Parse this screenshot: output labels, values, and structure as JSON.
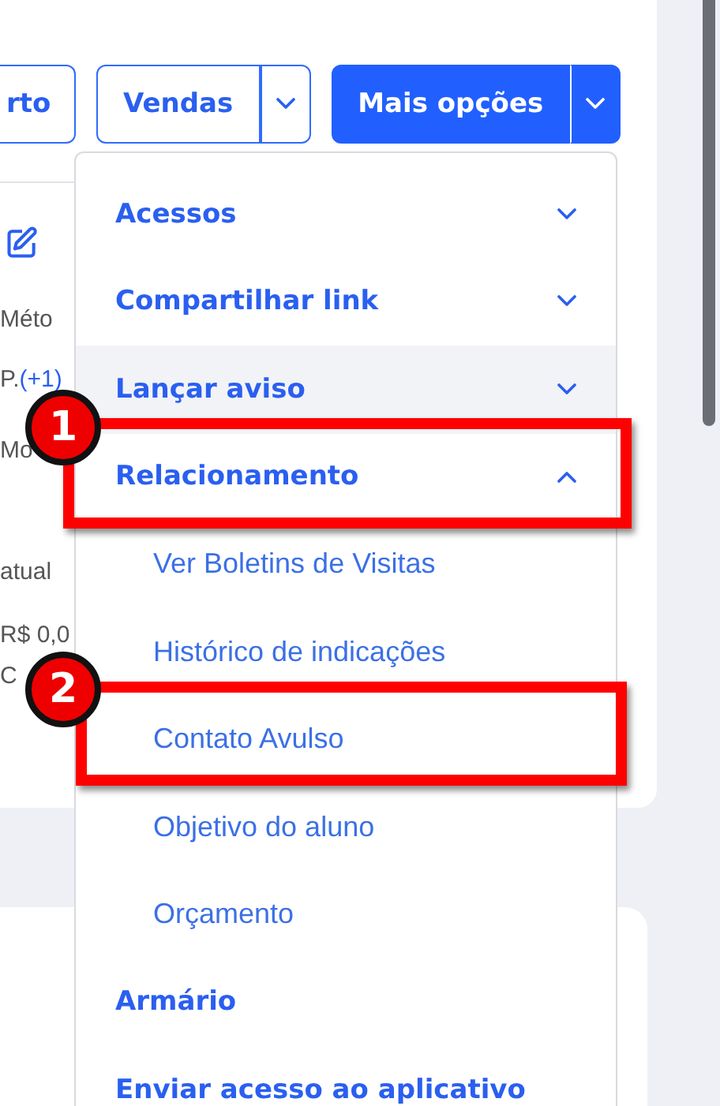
{
  "toolbar": {
    "buttons": [
      {
        "label": "rto",
        "kind": "outline"
      },
      {
        "label": "Vendas",
        "kind": "outline-split"
      },
      {
        "label": "Mais opções",
        "kind": "primary-split"
      }
    ]
  },
  "details": [
    {
      "text": "Méto"
    },
    {
      "text": "P.",
      "extra": "(+1)"
    },
    {
      "text": "Mo"
    },
    {
      "text": "atual"
    },
    {
      "text": "R$ 0,0"
    },
    {
      "text": "C"
    }
  ],
  "menu": {
    "items": [
      {
        "label": "Acessos",
        "kind": "group",
        "expanded": false,
        "hovered": false
      },
      {
        "label": "Compartilhar link",
        "kind": "group",
        "expanded": false,
        "hovered": false
      },
      {
        "label": "Lançar aviso",
        "kind": "group",
        "expanded": false,
        "hovered": true
      },
      {
        "label": "Relacionamento",
        "kind": "group",
        "expanded": true,
        "hovered": false,
        "children": [
          {
            "label": "Ver Boletins de Visitas"
          },
          {
            "label": "Histórico de indicações"
          },
          {
            "label": "Contato Avulso"
          },
          {
            "label": "Objetivo do aluno"
          },
          {
            "label": "Orçamento"
          }
        ]
      },
      {
        "label": "Armário",
        "kind": "link",
        "hovered": false
      },
      {
        "label": "Enviar acesso ao aplicativo",
        "kind": "link",
        "hovered": false
      }
    ]
  },
  "annotations": [
    {
      "number": "1"
    },
    {
      "number": "2"
    }
  ]
}
